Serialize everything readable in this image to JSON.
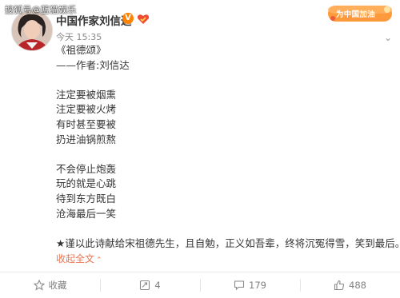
{
  "watermark": "搜狐号@蓝猫娱乐",
  "banner": {
    "text": "为中国加油"
  },
  "user": {
    "name": "中国作家刘信达",
    "verified_label": "V"
  },
  "post": {
    "meta": "今天 15:35",
    "lines": [
      "《祖德颂》",
      "——作者:刘信达",
      "",
      "注定要被烟熏",
      "注定要被火烤",
      "有时甚至要被",
      "扔进油锅煎熬",
      "",
      "不会停止炮轰",
      "玩的就是心跳",
      "待到东方既白",
      "沧海最后一笑",
      "",
      "★谨以此诗献给宋祖德先生，且自勉，正义如吾辈，终将沉冤得雪，笑到最后。"
    ],
    "collapse_label": "收起全文"
  },
  "actions": {
    "favorite": "收藏",
    "repost": "4",
    "comment": "179",
    "like": "488"
  },
  "colors": {
    "accent": "#eb7350",
    "verified": "#ff8200",
    "muted": "#808080"
  }
}
